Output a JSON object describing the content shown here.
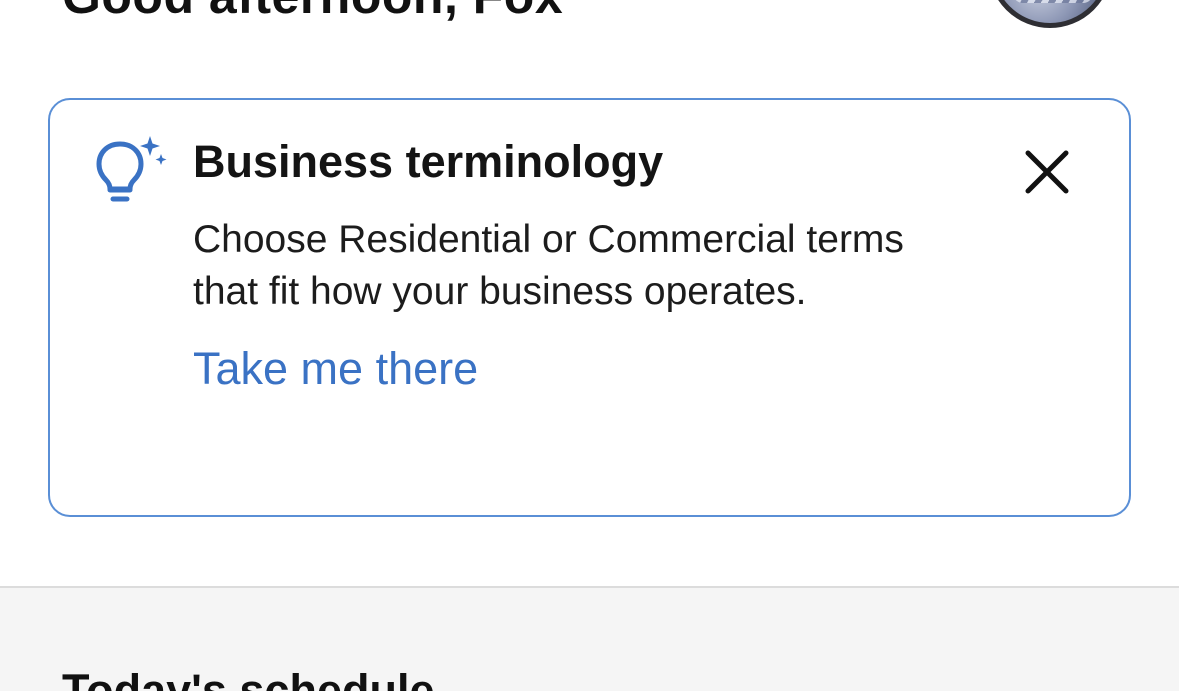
{
  "header": {
    "greeting": "Good afternoon, Fox",
    "avatar_icon": "user-avatar"
  },
  "tip_card": {
    "icon": "lightbulb-sparkle-icon",
    "title": "Business terminology",
    "body_line1": "Choose Residential or Commercial terms",
    "body_line2": "that fit how your business operates.",
    "link_label": "Take me there",
    "close_icon": "close-icon"
  },
  "schedule": {
    "section_title": "Today's schedule"
  },
  "colors": {
    "accent": "#3a72c4",
    "card_border": "#5a8fd6",
    "section_background": "#f5f5f5"
  }
}
